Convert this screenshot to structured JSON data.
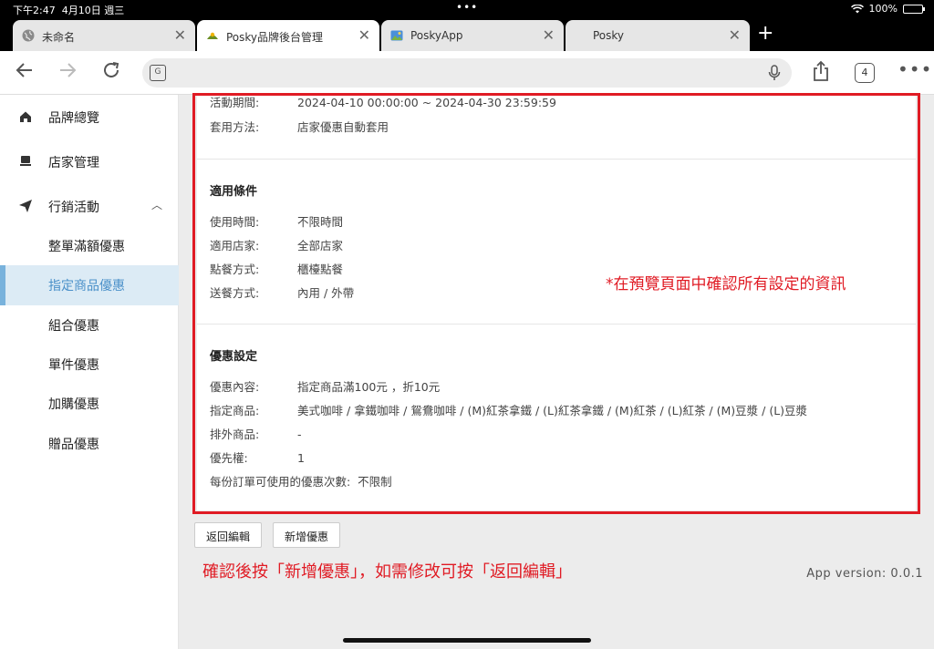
{
  "status": {
    "time": "下午2:47",
    "date": "4月10日 週三",
    "battery": "100%",
    "battery_level": 1.0
  },
  "tabs": [
    {
      "title": "未命名",
      "active": false
    },
    {
      "title": "Posky品牌後台管理",
      "active": true
    },
    {
      "title": "PoskyApp",
      "active": false
    },
    {
      "title": "Posky",
      "active": false
    }
  ],
  "toolbar": {
    "tab_count": "4"
  },
  "sidebar": {
    "nav": [
      {
        "label": "品牌總覽"
      },
      {
        "label": "店家管理"
      },
      {
        "label": "行銷活動"
      }
    ],
    "sub": [
      {
        "label": "整單滿額優惠"
      },
      {
        "label": "指定商品優惠"
      },
      {
        "label": "組合優惠"
      },
      {
        "label": "單件優惠"
      },
      {
        "label": "加購優惠"
      },
      {
        "label": "贈品優惠"
      }
    ]
  },
  "detail": {
    "period_label": "活動期間:",
    "period_value": "2024-04-10 00:00:00 ~ 2024-04-30 23:59:59",
    "apply_label": "套用方法:",
    "apply_value": "店家優惠自動套用",
    "conditions_title": "適用條件",
    "conditions": [
      {
        "k": "使用時間:",
        "v": "不限時間"
      },
      {
        "k": "適用店家:",
        "v": "全部店家"
      },
      {
        "k": "點餐方式:",
        "v": "櫃檯點餐"
      },
      {
        "k": "送餐方式:",
        "v": "內用 / 外帶"
      }
    ],
    "settings_title": "優惠設定",
    "settings": [
      {
        "k": "優惠內容:",
        "v": "指定商品滿100元 ，折10元"
      },
      {
        "k": "指定商品:",
        "v": "美式咖啡 / 拿鐵咖啡 / 鴛鴦咖啡 / (M)紅茶拿鐵 / (L)紅茶拿鐵 / (M)紅茶 / (L)紅茶 / (M)豆漿 / (L)豆漿"
      },
      {
        "k": "排外商品:",
        "v": "-"
      },
      {
        "k": "優先權:",
        "v": "1"
      }
    ],
    "per_order_label": "每份訂單可使用的優惠次數:",
    "per_order_value": "不限制"
  },
  "annotation_top": "*在預覽頁面中確認所有設定的資訊",
  "buttons": {
    "back": "返回編輯",
    "add": "新增優惠"
  },
  "annotation_bottom": "確認後按「新增優惠」，如需修改可按「返回編輯」",
  "version": "App version: 0.0.1"
}
